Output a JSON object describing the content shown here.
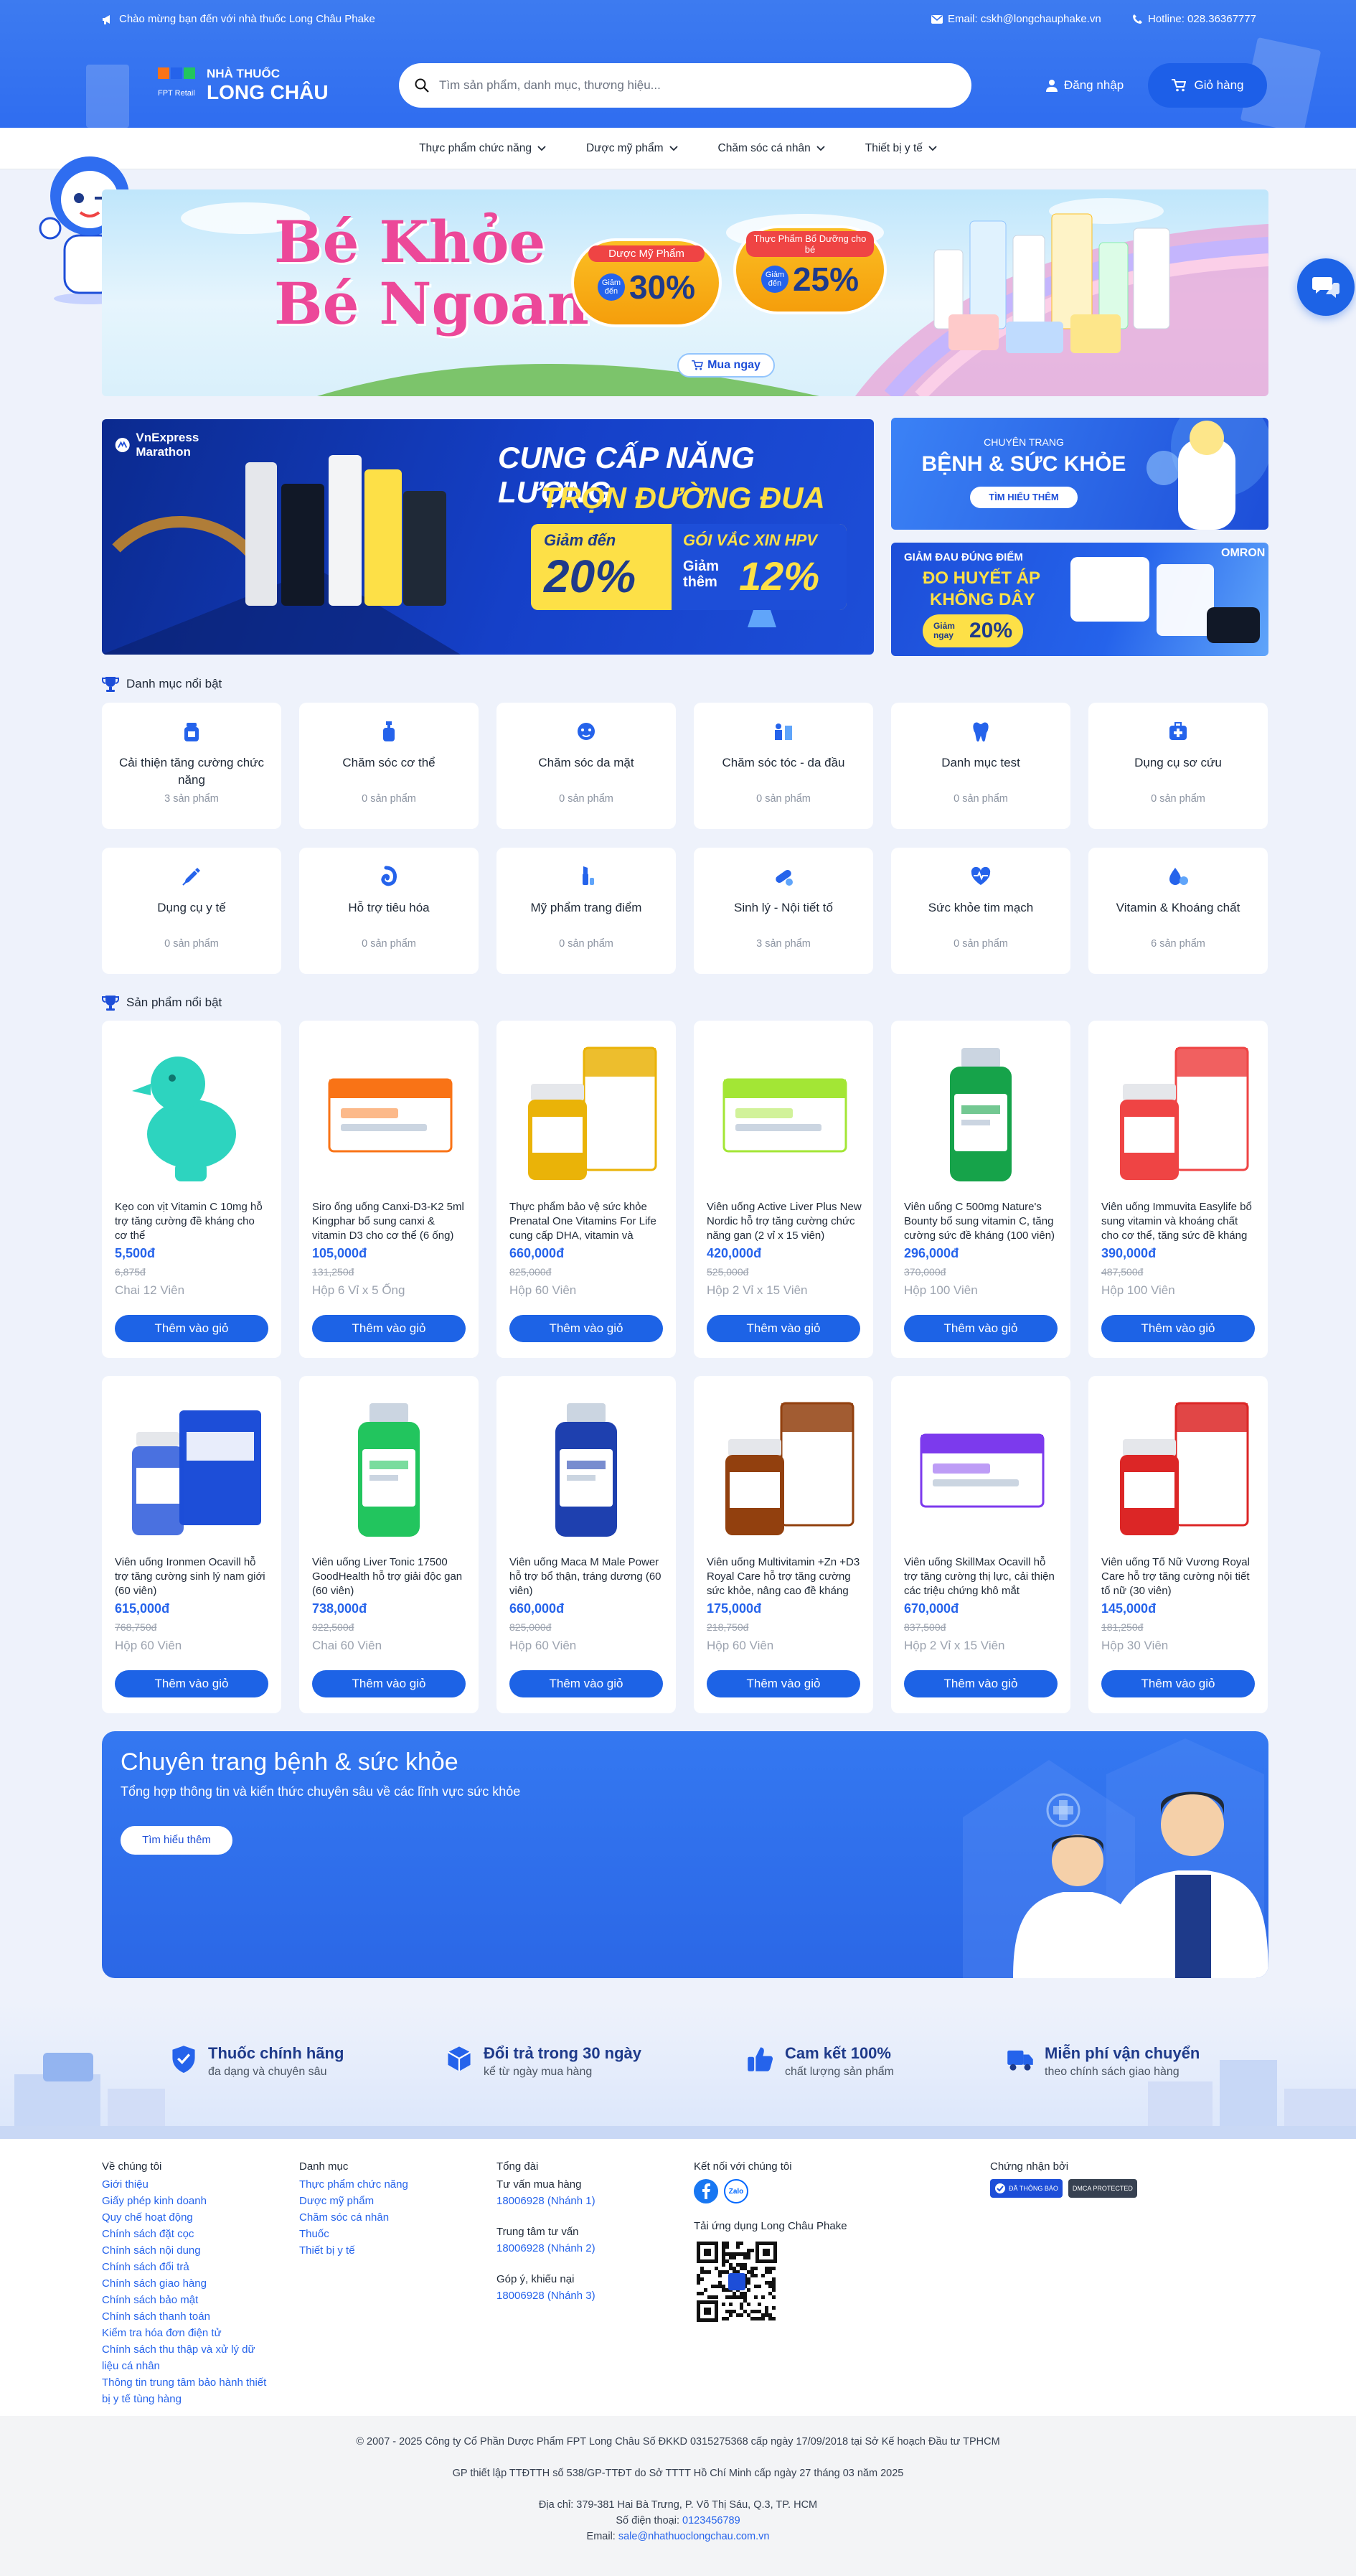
{
  "topbar": {
    "welcome": "Chào mừng bạn đến với nhà thuốc Long Châu Phake",
    "email": "Email: cskh@longchauphake.vn",
    "hotline": "Hotline: 028.36367777"
  },
  "header": {
    "brand_small": "FPT Retail",
    "brand_line1": "NHÀ THUỐC",
    "brand_line2": "LONG CHÂU",
    "search_placeholder": "Tìm sản phẩm, danh mục, thương hiệu...",
    "login_label": "Đăng nhập",
    "cart_label": "Giỏ hàng"
  },
  "nav": [
    "Thực phẩm chức năng",
    "Dược mỹ phẩm",
    "Chăm sóc cá nhân",
    "Thiết bị y tế"
  ],
  "hero": {
    "title1": "Bé Khỏe",
    "title2": "Bé Ngoan",
    "badge1_title": "Dược Mỹ Phẩm",
    "badge1_prefix": "Giảm đến",
    "badge1_value": "30%",
    "badge2_title": "Thực Phẩm Bổ Dưỡng cho bé",
    "badge2_prefix": "Giảm đến",
    "badge2_value": "25%",
    "cta": "Mua ngay"
  },
  "promo_main": {
    "brand": "VnExpress Marathon",
    "headline1": "CUNG CẤP NĂNG LƯỢNG",
    "headline2": "TRỌN ĐƯỜNG ĐUA",
    "left_prefix": "Giảm đến",
    "left_value": "20%",
    "right_line1": "GÓI VẮC XIN HPV",
    "right_prefix": "Giảm thêm",
    "right_value": "12%"
  },
  "promo_side1": {
    "small": "CHUYÊN TRANG",
    "title": "BỆNH & SỨC KHỎE",
    "cta": "TÌM HIỂU THÊM"
  },
  "promo_side2": {
    "line1": "GIẢM ĐAU ĐÚNG ĐIỂM",
    "line2": "ĐO HUYẾT ÁP",
    "line3": "KHÔNG DÂY",
    "brand": "OMRON",
    "prefix": "Giảm ngay",
    "value": "20%"
  },
  "categories_title": "Danh mục nổi bật",
  "categories": [
    {
      "name": "Cải thiện tăng cường chức năng",
      "count": "3 sản phẩm",
      "icon": "supplement-icon"
    },
    {
      "name": "Chăm sóc cơ thể",
      "count": "0 sản phẩm",
      "icon": "body-care-icon"
    },
    {
      "name": "Chăm sóc da mặt",
      "count": "0 sản phẩm",
      "icon": "face-care-icon"
    },
    {
      "name": "Chăm sóc tóc - da đầu",
      "count": "0 sản phẩm",
      "icon": "hair-care-icon"
    },
    {
      "name": "Danh mục test",
      "count": "0 sản phẩm",
      "icon": "tooth-icon"
    },
    {
      "name": "Dụng cụ sơ cứu",
      "count": "0 sản phẩm",
      "icon": "first-aid-icon"
    },
    {
      "name": "Dụng cụ y tế",
      "count": "0 sản phẩm",
      "icon": "syringe-icon"
    },
    {
      "name": "Hỗ trợ tiêu hóa",
      "count": "0 sản phẩm",
      "icon": "digestion-icon"
    },
    {
      "name": "Mỹ phẩm trang điểm",
      "count": "0 sản phẩm",
      "icon": "makeup-icon"
    },
    {
      "name": "Sinh lý - Nội tiết tố",
      "count": "3 sản phẩm",
      "icon": "pill-icon"
    },
    {
      "name": "Sức khỏe tim mạch",
      "count": "0 sản phẩm",
      "icon": "heart-pulse-icon"
    },
    {
      "name": "Vitamin & Khoáng chất",
      "count": "6 sản phẩm",
      "icon": "vitamin-icon"
    }
  ],
  "products_title": "Sản phẩm nổi bật",
  "add_to_cart": "Thêm vào giỏ",
  "products": [
    {
      "name": "Kẹo con vịt Vitamin C 10mg hỗ trợ tăng cường đề kháng cho cơ thể",
      "price": "5,500đ",
      "old_price": "6,875đ",
      "unit": "Chai 12 Viên",
      "color": "#2dd4bf"
    },
    {
      "name": "Siro ống uống Canxi-D3-K2 5ml Kingphar bổ sung canxi & vitamin D3 cho cơ thể (6 ống)",
      "price": "105,000đ",
      "old_price": "131,250đ",
      "unit": "Hộp 6 Vỉ x 5 Ống",
      "color": "#f97316"
    },
    {
      "name": "Thực phẩm bảo vệ sức khỏe Prenatal One Vitamins For Life cung cấp DHA, vitamin và khoáng chất",
      "price": "660,000đ",
      "old_price": "825,000đ",
      "unit": "Hộp 60 Viên",
      "color": "#eab308"
    },
    {
      "name": "Viên uống Active Liver Plus New Nordic hỗ trợ tăng cường chức năng gan (2 vỉ x 15 viên)",
      "price": "420,000đ",
      "old_price": "525,000đ",
      "unit": "Hộp 2 Vỉ x 15 Viên",
      "color": "#a3e635"
    },
    {
      "name": "Viên uống C 500mg Nature's Bounty bổ sung vitamin C, tăng cường sức đề kháng (100 viên)",
      "price": "296,000đ",
      "old_price": "370,000đ",
      "unit": "Hộp 100 Viên",
      "color": "#16a34a"
    },
    {
      "name": "Viên uống Immuvita Easylife bổ sung vitamin và khoáng chất cho cơ thể, tăng sức đề kháng",
      "price": "390,000đ",
      "old_price": "487,500đ",
      "unit": "Hộp 100 Viên",
      "color": "#ef4444"
    },
    {
      "name": "Viên uống Ironmen Ocavill hỗ trợ tăng cường sinh lý nam giới (60 viên)",
      "price": "615,000đ",
      "old_price": "768,750đ",
      "unit": "Hộp 60 Viên",
      "color": "#1d4ed8"
    },
    {
      "name": "Viên uống Liver Tonic 17500 GoodHealth hỗ trợ giải độc gan (60 viên)",
      "price": "738,000đ",
      "old_price": "922,500đ",
      "unit": "Chai 60 Viên",
      "color": "#22c55e"
    },
    {
      "name": "Viên uống Maca M Male Power hỗ trợ bổ thận, tráng dương (60 viên)",
      "price": "660,000đ",
      "old_price": "825,000đ",
      "unit": "Hộp 60 Viên",
      "color": "#1e40af"
    },
    {
      "name": "Viên uống Multivitamin +Zn +D3 Royal Care hỗ trợ tăng cường sức khỏe, nâng cao đề kháng",
      "price": "175,000đ",
      "old_price": "218,750đ",
      "unit": "Hộp 60 Viên",
      "color": "#92400e"
    },
    {
      "name": "Viên uống SkillMax Ocavill hỗ trợ tăng cường thị lực, cải thiện các triệu chứng khô mắt",
      "price": "670,000đ",
      "old_price": "837,500đ",
      "unit": "Hộp 2 Vỉ x 15 Viên",
      "color": "#7c3aed"
    },
    {
      "name": "Viên uống Tố Nữ Vương Royal Care hỗ trợ tăng cường nội tiết tố nữ (30 viên)",
      "price": "145,000đ",
      "old_price": "181,250đ",
      "unit": "Hộp 30 Viên",
      "color": "#dc2626"
    }
  ],
  "health_banner": {
    "title": "Chuyên trang bệnh & sức khỏe",
    "subtitle": "Tổng hợp thông tin và kiến thức chuyên sâu về các lĩnh vực sức khỏe",
    "cta": "Tìm hiểu thêm"
  },
  "features": [
    {
      "title": "Thuốc chính hãng",
      "sub": "đa dạng và chuyên sâu",
      "icon": "shield-check-icon"
    },
    {
      "title": "Đổi trả trong 30 ngày",
      "sub": "kể từ ngày mua hàng",
      "icon": "box-return-icon"
    },
    {
      "title": "Cam kết 100%",
      "sub": "chất lượng sản phẩm",
      "icon": "thumbs-up-icon"
    },
    {
      "title": "Miễn phí vận chuyển",
      "sub": "theo chính sách giao hàng",
      "icon": "truck-icon"
    }
  ],
  "footer": {
    "about_title": "Về chúng tôi",
    "about_links": [
      "Giới thiệu",
      "Giấy phép kinh doanh",
      "Quy chế hoạt động",
      "Chính sách đặt cọc",
      "Chính sách nội dung",
      "Chính sách đổi trả",
      "Chính sách giao hàng",
      "Chính sách bảo mật",
      "Chính sách thanh toán",
      "Kiểm tra hóa đơn điện tử",
      "Chính sách thu thập và xử lý dữ liệu cá nhân",
      "Thông tin trung tâm bảo hành thiết bị y tế tùng hàng"
    ],
    "cat_title": "Danh mục",
    "cat_links": [
      "Thực phẩm chức năng",
      "Dược mỹ phẩm",
      "Chăm sóc cá nhân",
      "Thuốc",
      "Thiết bị y tế"
    ],
    "hotline_title": "Tổng đài",
    "hotline_groups": [
      {
        "label": "Tư vấn mua hàng",
        "value": "18006928 (Nhánh 1)"
      },
      {
        "label": "Trung tâm tư vấn",
        "value": "18006928 (Nhánh 2)"
      },
      {
        "label": "Góp ý, khiếu nại",
        "value": "18006928 (Nhánh 3)"
      }
    ],
    "social_title": "Kết nối với chúng tôi",
    "zalo": "Zalo",
    "app_title": "Tải ứng dụng Long Châu Phake",
    "cert_title": "Chứng nhận bởi",
    "cert1": "ĐÃ THÔNG BÁO",
    "cert2": "DMCA PROTECTED"
  },
  "bottom": {
    "line1": "© 2007 - 2025 Công ty Cổ Phần Dược Phẩm FPT Long Châu Số ĐKKD 0315275368 cấp ngày 17/09/2018 tại Sở Kế hoạch Đầu tư TPHCM",
    "line2": "GP thiết lập TTĐTTH số 538/GP-TTĐT do Sở TTTT Hồ Chí Minh cấp ngày 27 tháng 03 năm 2025",
    "address": "Địa chỉ: 379-381 Hai Bà Trưng, P. Võ Thị Sáu, Q.3, TP. HCM",
    "phone_label": "Số điện thoại: ",
    "phone": "0123456789",
    "email_label": "Email: ",
    "email": "sale@nhathuoclongchau.com.vn"
  },
  "colors": {
    "brand": "#2f6df0",
    "button": "#1d63e6",
    "price": "#2563eb",
    "page_bg": "#eef2fb"
  }
}
